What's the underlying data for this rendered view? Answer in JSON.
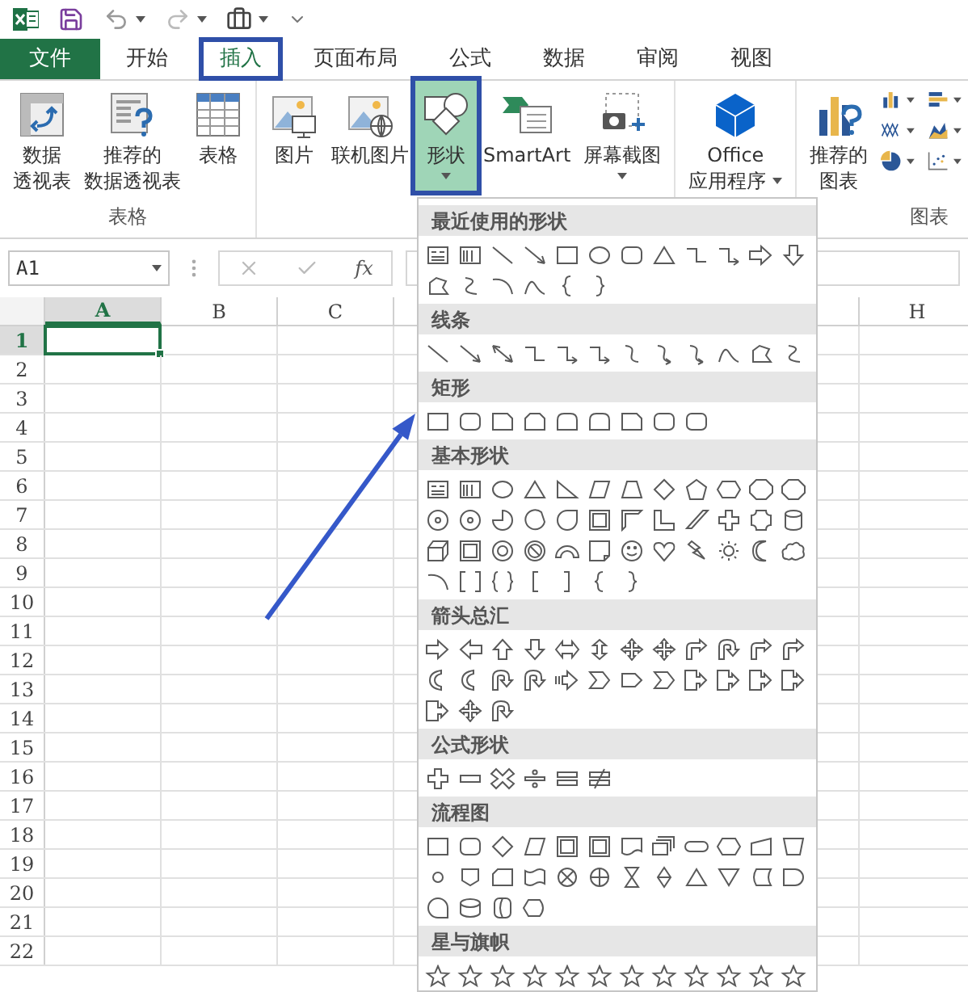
{
  "tabs": [
    {
      "label": "文件",
      "kind": "file",
      "selected": false
    },
    {
      "label": "开始",
      "kind": "tab",
      "selected": false
    },
    {
      "label": "插入",
      "kind": "tab",
      "selected": true
    },
    {
      "label": "页面布局",
      "kind": "tab",
      "selected": false
    },
    {
      "label": "公式",
      "kind": "tab",
      "selected": false
    },
    {
      "label": "数据",
      "kind": "tab",
      "selected": false
    },
    {
      "label": "审阅",
      "kind": "tab",
      "selected": false
    },
    {
      "label": "视图",
      "kind": "tab",
      "selected": false
    }
  ],
  "ribbon_groups": [
    {
      "label": "表格",
      "buttons": [
        {
          "lines": [
            "数据",
            "透视表"
          ]
        },
        {
          "lines": [
            "推荐的",
            "数据透视表"
          ]
        },
        {
          "lines": [
            "表格"
          ]
        }
      ]
    },
    {
      "buttons": [
        {
          "lines": [
            "图片"
          ]
        },
        {
          "lines": [
            "联机图片"
          ]
        },
        {
          "lines": [
            "形状"
          ],
          "dropdown": true,
          "expanded": true
        },
        {
          "lines": [
            "SmartArt"
          ]
        },
        {
          "lines": [
            "屏幕截图"
          ],
          "dropdown": true
        }
      ]
    },
    {
      "buttons": [
        {
          "lines": [
            "Office",
            "应用程序"
          ],
          "dropdown": true
        }
      ]
    },
    {
      "label": "图表",
      "buttons": [
        {
          "lines": [
            "推荐的",
            "图表"
          ]
        }
      ]
    }
  ],
  "name_box": {
    "value": "A1"
  },
  "formula_bar": {
    "function_button": "fx"
  },
  "columns": [
    {
      "label": "A",
      "selected": true
    },
    {
      "label": "B",
      "selected": false
    },
    {
      "label": "C",
      "selected": false
    },
    {
      "label": "H",
      "selected": false
    }
  ],
  "rows": [
    {
      "label": "1",
      "selected": true
    },
    {
      "label": "2",
      "selected": false
    },
    {
      "label": "3",
      "selected": false
    },
    {
      "label": "4",
      "selected": false
    },
    {
      "label": "5",
      "selected": false
    },
    {
      "label": "6",
      "selected": false
    },
    {
      "label": "7",
      "selected": false
    },
    {
      "label": "8",
      "selected": false
    },
    {
      "label": "9",
      "selected": false
    },
    {
      "label": "10",
      "selected": false
    },
    {
      "label": "11",
      "selected": false
    },
    {
      "label": "12",
      "selected": false
    },
    {
      "label": "13",
      "selected": false
    },
    {
      "label": "14",
      "selected": false
    },
    {
      "label": "15",
      "selected": false
    },
    {
      "label": "16",
      "selected": false
    },
    {
      "label": "17",
      "selected": false
    },
    {
      "label": "18",
      "selected": false
    },
    {
      "label": "19",
      "selected": false
    },
    {
      "label": "20",
      "selected": false
    },
    {
      "label": "21",
      "selected": false
    },
    {
      "label": "22",
      "selected": false
    }
  ],
  "shapes_menu": {
    "sections": [
      {
        "title": "最近使用的形状"
      },
      {
        "title": "线条"
      },
      {
        "title": "矩形"
      },
      {
        "title": "基本形状"
      },
      {
        "title": "箭头总汇"
      },
      {
        "title": "公式形状"
      },
      {
        "title": "流程图"
      },
      {
        "title": "星与旗帜"
      }
    ]
  }
}
